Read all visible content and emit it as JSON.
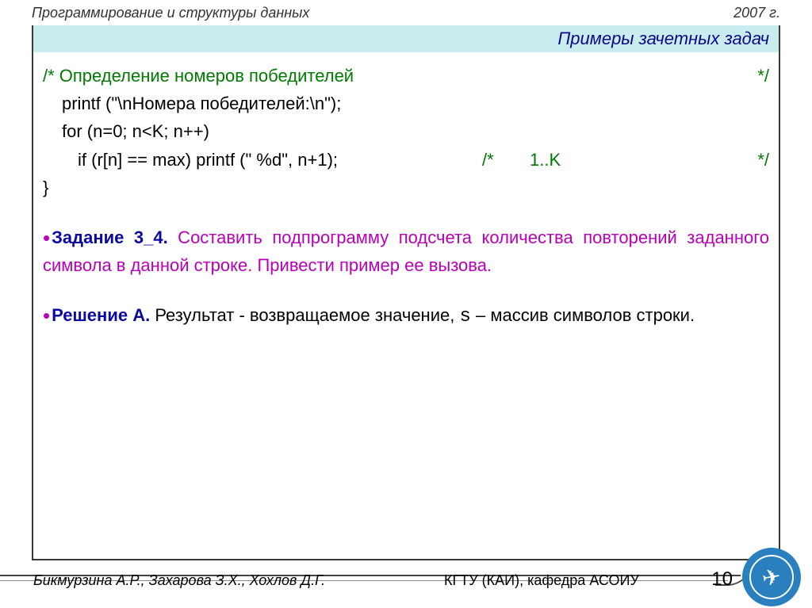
{
  "header": {
    "left": "Программирование  и структуры данных",
    "right": "2007 г."
  },
  "title": "Примеры зачетных задач",
  "code": {
    "c1_left": "/* Определение номеров победителей",
    "c1_right": "*/",
    "l1": "printf (\"\\nНомера победителей:\\n\");",
    "l2": "for (n=0; n<K; n++)",
    "l3_code": "if (r[n] == max) printf (\" %d\", n+1);",
    "l3_cm_open": "/*",
    "l3_cm_body": "1..K",
    "l3_cm_close": "*/",
    "l4": "}"
  },
  "task": {
    "label": "Задание 3_4.",
    "text": " Составить подпрограмму подсчета количества повторений заданного символа в данной строке. Привести пример ее вызова."
  },
  "solution": {
    "label": "Решение А.",
    "before_s": " Результат - возвращаемое значение, ",
    "s": "s",
    "after_s": " – массив символов строки."
  },
  "footer": {
    "authors": "Бикмурзина А.Р., Захарова З.Х., Хохлов Д.Г.",
    "org": "КГТУ  (КАИ),  кафедра АСОИУ",
    "page": "10"
  }
}
